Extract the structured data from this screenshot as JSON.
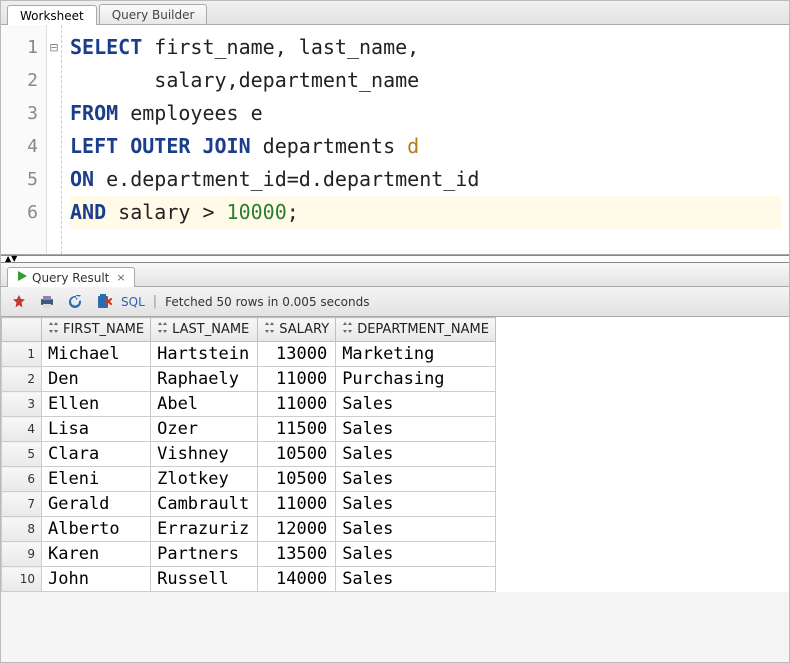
{
  "tabs": {
    "worksheet": "Worksheet",
    "query_builder": "Query Builder"
  },
  "editor": {
    "lines": [
      {
        "n": "1",
        "hl": false,
        "tokens": [
          {
            "t": "SELECT",
            "c": "kw"
          },
          {
            "t": " first_name, last_name,",
            "c": ""
          }
        ]
      },
      {
        "n": "2",
        "hl": false,
        "tokens": [
          {
            "t": "       salary,department_name",
            "c": ""
          }
        ]
      },
      {
        "n": "3",
        "hl": false,
        "tokens": [
          {
            "t": "FROM",
            "c": "kw"
          },
          {
            "t": " employees e",
            "c": ""
          }
        ]
      },
      {
        "n": "4",
        "hl": false,
        "tokens": [
          {
            "t": "LEFT OUTER JOIN",
            "c": "kw"
          },
          {
            "t": " departments ",
            "c": ""
          },
          {
            "t": "d",
            "c": "ident-alias"
          }
        ]
      },
      {
        "n": "5",
        "hl": false,
        "tokens": [
          {
            "t": "ON",
            "c": "kw"
          },
          {
            "t": " e.department_id=d.department_id",
            "c": ""
          }
        ]
      },
      {
        "n": "6",
        "hl": true,
        "tokens": [
          {
            "t": "AND",
            "c": "kw"
          },
          {
            "t": " salary > ",
            "c": ""
          },
          {
            "t": "10000",
            "c": "num"
          },
          {
            "t": ";",
            "c": ""
          }
        ]
      }
    ],
    "fold_marker": "⊟"
  },
  "result_tab": {
    "label": "Query Result",
    "close": "×"
  },
  "toolbar": {
    "pin": "pin",
    "print": "print",
    "refresh": "refresh",
    "delete": "delete",
    "sql_link": "SQL",
    "status": "Fetched 50 rows in 0.005 seconds"
  },
  "grid": {
    "columns": [
      "FIRST_NAME",
      "LAST_NAME",
      "SALARY",
      "DEPARTMENT_NAME"
    ],
    "numeric_cols": [
      2
    ],
    "rows": [
      [
        "Michael",
        "Hartstein",
        "13000",
        "Marketing"
      ],
      [
        "Den",
        "Raphaely",
        "11000",
        "Purchasing"
      ],
      [
        "Ellen",
        "Abel",
        "11000",
        "Sales"
      ],
      [
        "Lisa",
        "Ozer",
        "11500",
        "Sales"
      ],
      [
        "Clara",
        "Vishney",
        "10500",
        "Sales"
      ],
      [
        "Eleni",
        "Zlotkey",
        "10500",
        "Sales"
      ],
      [
        "Gerald",
        "Cambrault",
        "11000",
        "Sales"
      ],
      [
        "Alberto",
        "Errazuriz",
        "12000",
        "Sales"
      ],
      [
        "Karen",
        "Partners",
        "13500",
        "Sales"
      ],
      [
        "John",
        "Russell",
        "14000",
        "Sales"
      ]
    ]
  }
}
